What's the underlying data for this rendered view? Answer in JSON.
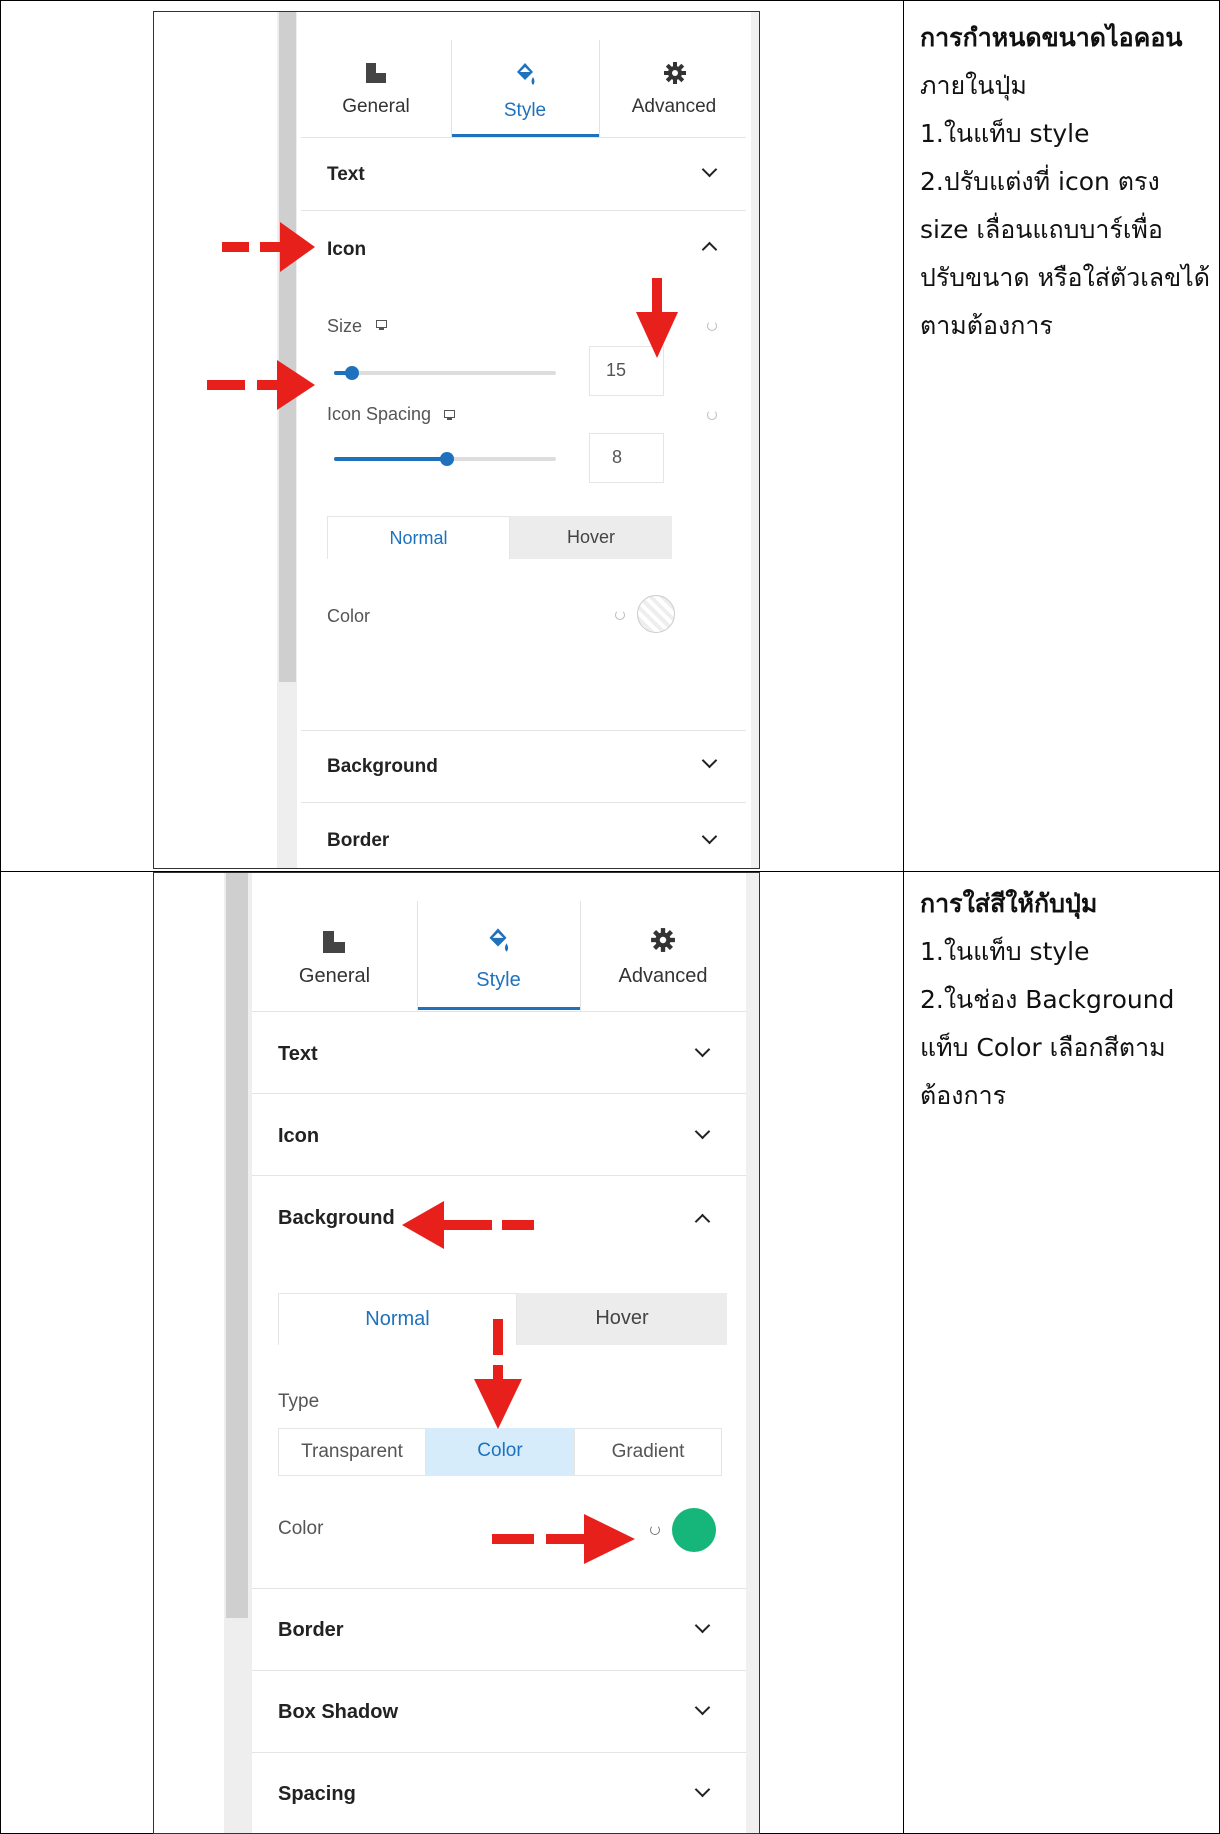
{
  "rows": [
    {
      "heading": "การกำหนดขนาดไอคอน",
      "lines": [
        "ภายในปุ่ม",
        "1.ในแท็บ style",
        "2.ปรับแต่งที่ icon ตรง",
        "size เลื่อนแถบบาร์เพื่อ",
        "ปรับขนาด หรือใส่ตัวเลขได้",
        "ตามต้องการ"
      ],
      "panel": {
        "tabs": [
          "General",
          "Style",
          "Advanced"
        ],
        "sections_before": [
          "Text"
        ],
        "open_section": "Icon",
        "size_label": "Size",
        "size_value": "15",
        "size_level": 0.08,
        "spacing_label": "Icon Spacing",
        "spacing_value": "8",
        "spacing_level": 0.51,
        "state_tabs": [
          "Normal",
          "Hover"
        ],
        "color_label": "Color",
        "sections_after": [
          "Background",
          "Border"
        ]
      }
    },
    {
      "heading": "การใส่สีให้กับปุ่ม",
      "lines": [
        "1.ในแท็บ style",
        "2.ในช่อง Background",
        "แท็บ Color เลือกสีตาม",
        "ต้องการ"
      ],
      "panel": {
        "tabs": [
          "General",
          "Style",
          "Advanced"
        ],
        "sections_before": [
          "Text",
          "Icon"
        ],
        "open_section": "Background",
        "state_tabs": [
          "Normal",
          "Hover"
        ],
        "type_label": "Type",
        "type_options": [
          "Transparent",
          "Color",
          "Gradient"
        ],
        "color_label": "Color",
        "color_value": "#16b67a",
        "sections_after": [
          "Border",
          "Box Shadow",
          "Spacing"
        ]
      }
    }
  ],
  "colors": {
    "accent": "#1e72bd",
    "arrow": "#e8201b",
    "selected_type_bg": "#d7ecfb"
  }
}
